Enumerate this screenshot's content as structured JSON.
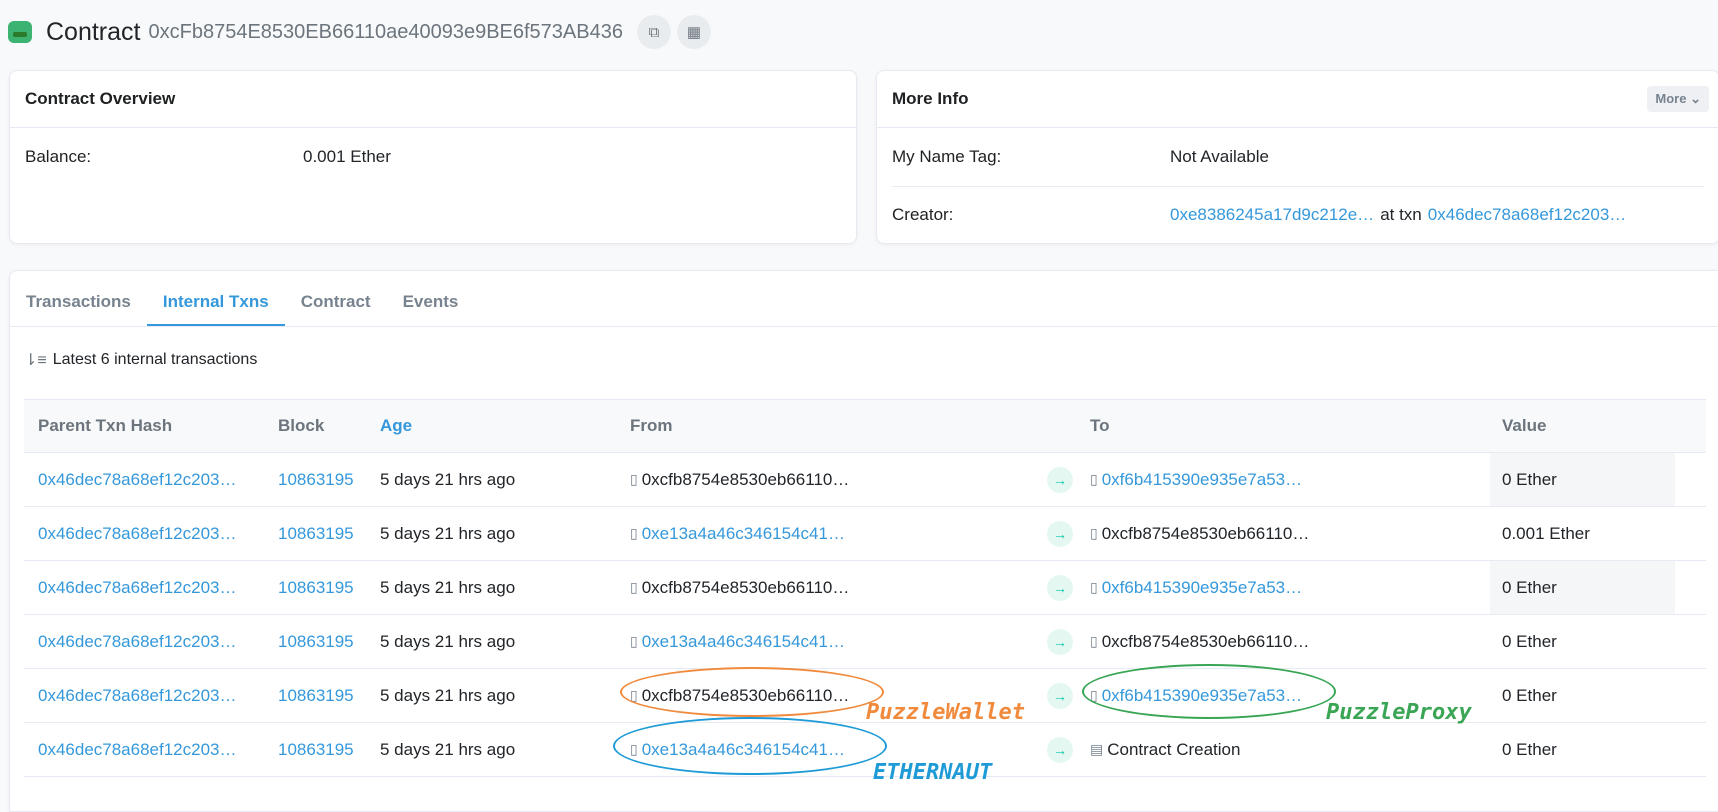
{
  "header": {
    "title": "Contract",
    "address": "0xcFb8754E8530EB66110ae40093e9BE6f573AB436"
  },
  "overview": {
    "title": "Contract Overview",
    "balance_label": "Balance:",
    "balance_value": "0.001 Ether"
  },
  "more_info": {
    "title": "More Info",
    "more_button": "More",
    "name_tag_label": "My Name Tag:",
    "name_tag_value": "Not Available",
    "creator_label": "Creator:",
    "creator_address": "0xe8386245a17d9c212e…",
    "at_txn": "at txn",
    "creator_txn": "0x46dec78a68ef12c203…"
  },
  "tabs": [
    "Transactions",
    "Internal Txns",
    "Contract",
    "Events"
  ],
  "subheading": "Latest 6 internal transactions",
  "table": {
    "headers": [
      "Parent Txn Hash",
      "Block",
      "Age",
      "From",
      "To",
      "Value"
    ],
    "rows": [
      {
        "hash": "0x46dec78a68ef12c203…",
        "block": "10863195",
        "age": "5 days 21 hrs ago",
        "from": "0xcfb8754e8530eb66110…",
        "to": "0xf6b415390e935e7a53…",
        "value": "0 Ether"
      },
      {
        "hash": "0x46dec78a68ef12c203…",
        "block": "10863195",
        "age": "5 days 21 hrs ago",
        "from": "0xe13a4a46c346154c41…",
        "to": "0xcfb8754e8530eb66110…",
        "value": "0.001 Ether"
      },
      {
        "hash": "0x46dec78a68ef12c203…",
        "block": "10863195",
        "age": "5 days 21 hrs ago",
        "from": "0xcfb8754e8530eb66110…",
        "to": "0xf6b415390e935e7a53…",
        "value": "0 Ether"
      },
      {
        "hash": "0x46dec78a68ef12c203…",
        "block": "10863195",
        "age": "5 days 21 hrs ago",
        "from": "0xe13a4a46c346154c41…",
        "to": "0xcfb8754e8530eb66110…",
        "value": "0 Ether"
      },
      {
        "hash": "0x46dec78a68ef12c203…",
        "block": "10863195",
        "age": "5 days 21 hrs ago",
        "from": "0xcfb8754e8530eb66110…",
        "to": "0xf6b415390e935e7a53…",
        "value": "0 Ether"
      },
      {
        "hash": "0x46dec78a68ef12c203…",
        "block": "10863195",
        "age": "5 days 21 hrs ago",
        "from": "0xe13a4a46c346154c41…",
        "to": "Contract Creation",
        "value": "0 Ether"
      }
    ]
  },
  "annotations": {
    "puzzle_wallet": "PuzzleWallet",
    "puzzle_proxy": "PuzzleProxy",
    "ethernaut": "ETHERNAUT",
    "colors": {
      "orange": "#f08a3c",
      "green": "#3aa655",
      "blue": "#1e9bd7"
    }
  }
}
